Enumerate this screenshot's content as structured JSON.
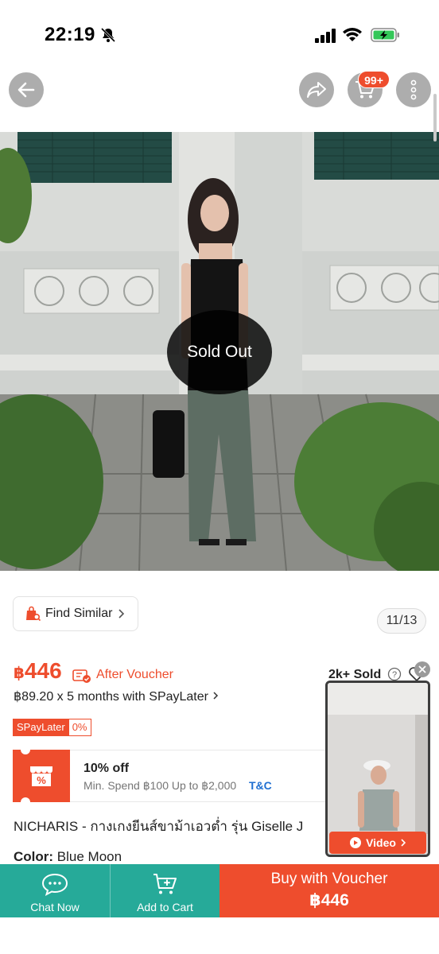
{
  "status_bar": {
    "time": "22:19"
  },
  "nav": {
    "cart_badge": "99+"
  },
  "hero": {
    "sold_out_label": "Sold Out",
    "image_counter": "11/13"
  },
  "find_similar": {
    "label": "Find Similar"
  },
  "price": {
    "currency": "฿",
    "amount": "446",
    "after_voucher": "After Voucher",
    "sold": "2k+ Sold",
    "installment": "฿89.20 x 5 months with SPayLater",
    "spaylater_badge": "SPayLater",
    "spaylater_rate": "0%"
  },
  "coupon": {
    "title": "10% off",
    "condition": "Min. Spend ฿100 Up to ฿2,000",
    "tc": "T&C"
  },
  "product": {
    "title": "NICHARIS - กางเกงยีนส์ขาม้าเอวต่ำ รุ่น Giselle J",
    "color_label": "Color:",
    "color_value": "Blue Moon"
  },
  "video": {
    "button_label": "Video"
  },
  "bottom_bar": {
    "chat_label": "Chat Now",
    "add_to_cart_label": "Add to Cart",
    "buy_label": "Buy with Voucher",
    "buy_price": "฿446"
  },
  "colors": {
    "accent": "#ee4d2d",
    "secondary": "#26aa99",
    "link": "#1f6fd1"
  }
}
